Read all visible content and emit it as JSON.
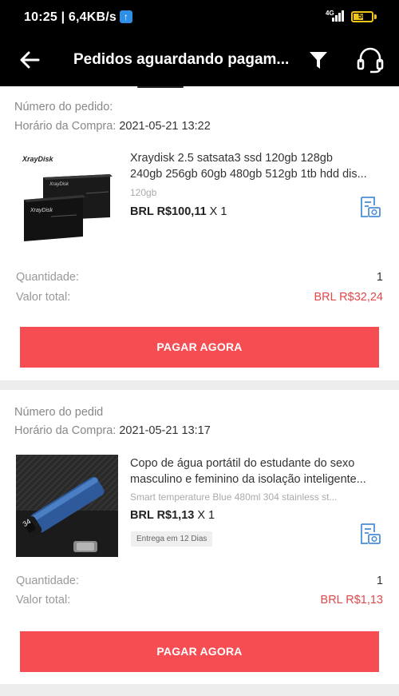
{
  "statusbar": {
    "time_speed": "10:25 | 6,4KB/s",
    "upload_icon": "upload-arrow-icon",
    "network": "4G",
    "battery_level": "55",
    "battery_fraction": 0.55
  },
  "toolbar": {
    "title": "Pedidos aguardando pagam...",
    "back_icon": "back-arrow-icon",
    "filter_icon": "filter-icon",
    "support_icon": "headset-icon"
  },
  "orders": [
    {
      "order_number_label": "Número do pedido:",
      "order_number_value": "",
      "purchase_time_label": "Horário da Compra:",
      "purchase_time_value": "2021-05-21 13:22",
      "product_title_line1": "Xraydisk 2.5 satsata3 ssd 120gb 128gb",
      "product_title_line2": "240gb 256gb 60gb 480gb 512gb 1tb hdd dis...",
      "product_image_brand": "XrayDisk",
      "variant": "120gb",
      "price": "BRL R$100,11",
      "quantity": "X 1",
      "delivery_tag": "",
      "quantity_label": "Quantidade:",
      "quantity_value": "1",
      "total_label": "Valor total:",
      "total_value": "BRL R$32,24",
      "pay_button": "PAGAR AGORA"
    },
    {
      "order_number_label": "Número do pedid",
      "order_number_value": "",
      "purchase_time_label": "Horário da Compra:",
      "purchase_time_value": "2021-05-21 13:17",
      "product_title_line1": "Copo de água portátil do estudante do sexo",
      "product_title_line2": "masculino e feminino da isolação inteligente...",
      "variant": "Smart temperature  Blue 480ml 304 stainless st...",
      "price": "BRL R$1,13",
      "quantity": "X 1",
      "delivery_tag": "Entrega em 12 Dias",
      "quantity_label": "Quantidade:",
      "quantity_value": "1",
      "total_label": "Valor total:",
      "total_value": "BRL R$1,13",
      "pay_button": "PAGAR AGORA"
    }
  ],
  "colors": {
    "accent_red": "#f54d52",
    "total_red": "#e0484a",
    "icon_blue": "#4a8fd6",
    "bar_black": "#000000"
  }
}
